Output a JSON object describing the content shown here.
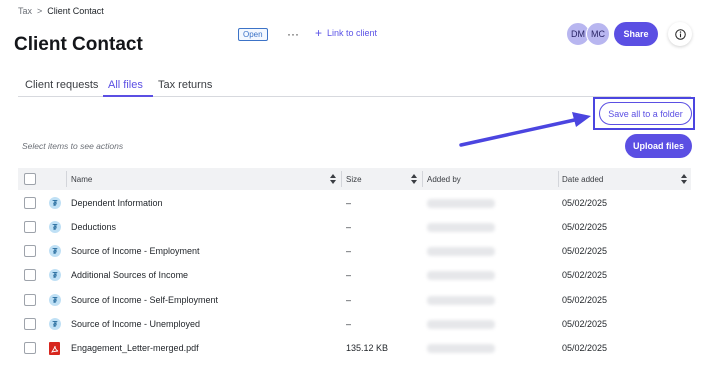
{
  "breadcrumb": {
    "root": "Tax",
    "separator": ">",
    "current": "Client Contact"
  },
  "page": {
    "title": "Client Contact",
    "status_badge": "Open",
    "more_label": "···",
    "link_client_label": "Link to client"
  },
  "header": {
    "avatars": [
      {
        "initials": "DM"
      },
      {
        "initials": "MC"
      }
    ],
    "share_label": "Share",
    "info_icon": "info-icon"
  },
  "tabs": [
    {
      "label": "Client requests",
      "active": false
    },
    {
      "label": "All files",
      "active": true
    },
    {
      "label": "Tax returns",
      "active": false
    }
  ],
  "actions": {
    "save_all_label": "Save all to a folder",
    "select_hint": "Select items to see actions",
    "upload_label": "Upload files"
  },
  "table": {
    "columns": [
      "Name",
      "Size",
      "Added by",
      "Date added"
    ],
    "rows": [
      {
        "icon": "tax-document-icon",
        "name": "Dependent Information",
        "size": "–",
        "added_by": "",
        "date": "05/02/2025"
      },
      {
        "icon": "tax-document-icon",
        "name": "Deductions",
        "size": "–",
        "added_by": "",
        "date": "05/02/2025"
      },
      {
        "icon": "tax-document-icon",
        "name": "Source of Income - Employment",
        "size": "–",
        "added_by": "",
        "date": "05/02/2025"
      },
      {
        "icon": "tax-document-icon",
        "name": "Additional Sources of Income",
        "size": "–",
        "added_by": "",
        "date": "05/02/2025"
      },
      {
        "icon": "tax-document-icon",
        "name": "Source of Income - Self-Employment",
        "size": "–",
        "added_by": "",
        "date": "05/02/2025"
      },
      {
        "icon": "tax-document-icon",
        "name": "Source of Income - Unemployed",
        "size": "–",
        "added_by": "",
        "date": "05/02/2025"
      },
      {
        "icon": "pdf-icon",
        "name": "Engagement_Letter-merged.pdf",
        "size": "135.12 KB",
        "added_by": "",
        "date": "05/02/2025"
      }
    ]
  },
  "colors": {
    "accent": "#5b4fe3",
    "annotation": "#4b45e0",
    "badge": "#3c73c7"
  }
}
